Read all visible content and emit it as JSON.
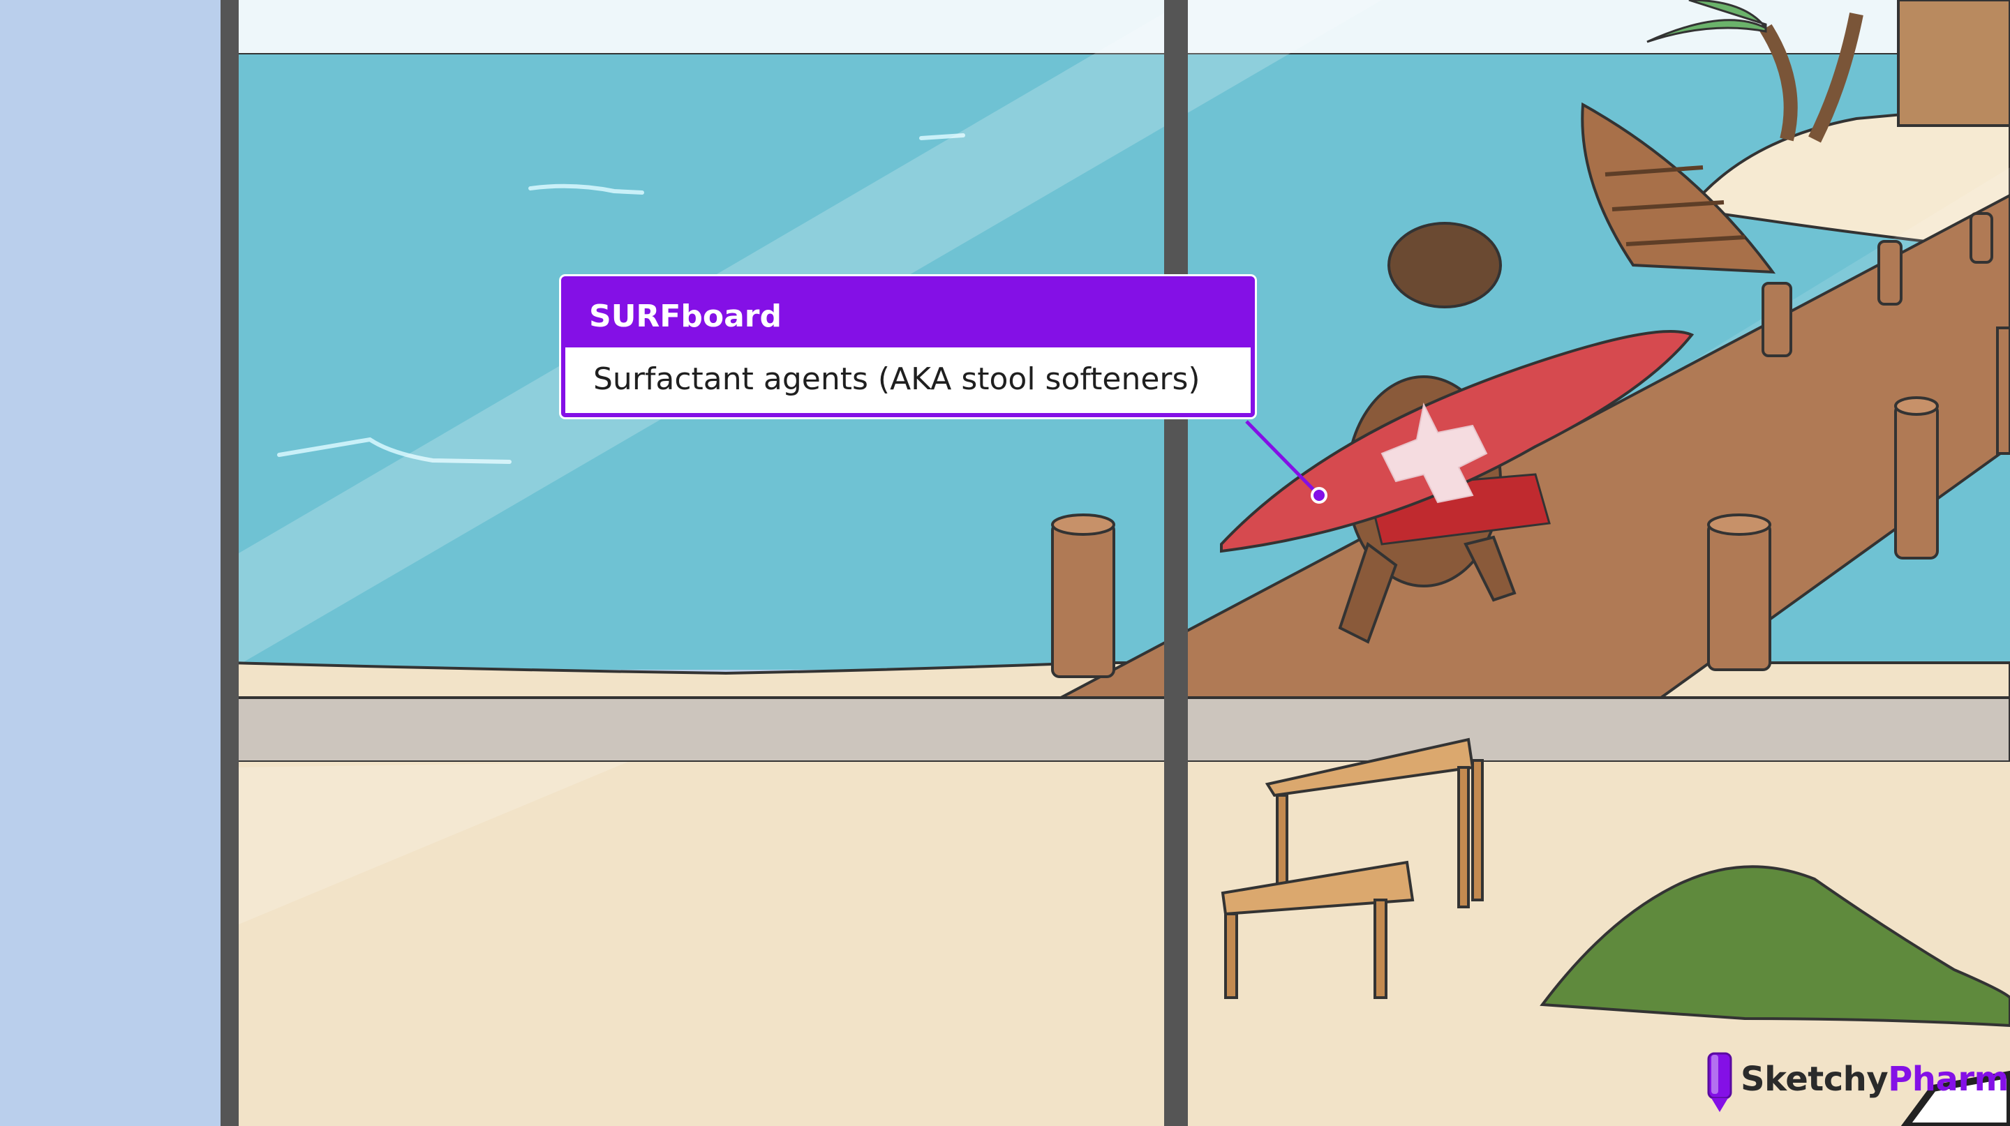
{
  "callout": {
    "title": "SURFboard",
    "text": "Surfactant agents (AKA stool softeners)"
  },
  "brand": {
    "part1": "Sketchy",
    "part2": "Pharm",
    "icon": "pencil-logo-icon"
  },
  "colors": {
    "accent": "#8410e6",
    "ocean": "#6fc2d3",
    "sand": "#f2e3c8",
    "sky": "#eef7fa",
    "dock": "#b07a55",
    "surfboard": "#d64a4f",
    "wall": "#bacfec"
  }
}
